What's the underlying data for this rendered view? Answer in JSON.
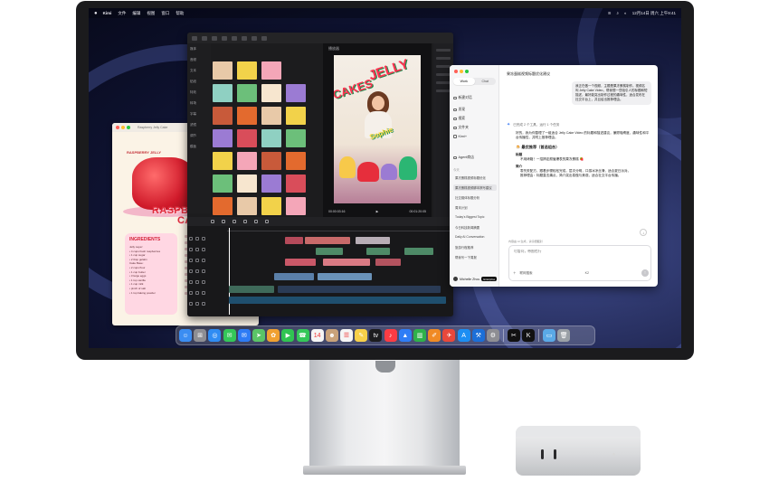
{
  "menubar": {
    "app_name": "Kimi",
    "items": [
      "文件",
      "编辑",
      "视图",
      "窗口",
      "帮助"
    ],
    "time": "12月14日 周六 上午9:41"
  },
  "recipe": {
    "doc_name": "Raspberry Jelly Cake",
    "kicker": "RASPBERRY JELLY",
    "headline_1": "RASPBERRY",
    "headline_2": "CAKE",
    "ingredients_title": "INGREDIENTS",
    "ingredients": [
      "Jelly Layer:",
      "• 4 cups fresh raspberries",
      "• 1 cup sugar",
      "• 2 tbsp gelatin",
      "Cake Base:",
      "• 2 cups flour",
      "• 1 cup butter",
      "• 3 large eggs",
      "• 1 tsp vanilla",
      "• 1 cup milk",
      "• pinch of salt",
      "• 1 tsp baking powder"
    ]
  },
  "editor": {
    "categories": [
      "媒体",
      "音频",
      "文本",
      "贴纸",
      "特效",
      "转场",
      "字幕",
      "滤镜",
      "调节",
      "模板"
    ],
    "preview_label": "播放器",
    "jelly_word": "JELLY",
    "cakes_word": "CAKES",
    "sophie_word": "Sophie",
    "timecode": "00:00:03:16",
    "duration": "00:01:20:05"
  },
  "chat": {
    "mode_work": "Work",
    "mode_chat": "Chat",
    "side_items": [
      "新建对话",
      "发现",
      "搜索",
      "文件夹",
      "Kimi+",
      "Agent商店"
    ],
    "section_recent": "今天",
    "conversations": [
      {
        "title": "果冻蛋糕视频标题优化",
        "selected": false
      },
      {
        "title": "果冻蛋糕视频脚本撰写建议",
        "selected": true
      },
      {
        "title": "社交媒体标题分析",
        "selected": false
      },
      {
        "title": "周末计划",
        "selected": false
      },
      {
        "title": "Today's Biggest Topic",
        "selected": false
      },
      {
        "title": "今日科技新闻摘要",
        "selected": false
      },
      {
        "title": "Daily AI Conversation",
        "selected": false
      },
      {
        "title": "旅游行程推荐",
        "selected": false
      },
      {
        "title": "帮我写一下周报",
        "selected": false
      }
    ],
    "user_name": "Michelle Zhou",
    "user_badge": "Enterprise",
    "title": "果冻蛋糕视频标题优化建议",
    "user_message": "我正在做一个视频，主题是果冻蛋糕制作。视频名叫 Jelly Cake Video，帮我想一些吸引人的标题和短描述，最好能突出制作过程的趣味性，适合发布在社交平台上，并且给出推荐理由。",
    "thinking": "已完成 2 个工具，运行 1 个任务",
    "answer_intro": "好的，我为你整理了一组适合 Jelly Cake Video 的标题和描述建议，兼顾吸睛度、趣味性和平台传播性，并附上推荐理由。",
    "answer_heading": "🍮 最优推荐（首选组合）",
    "answer_sub1": "标题",
    "answer_line1": "不用烤箱！一招搞定颜值爆表的果冻蛋糕 🍓",
    "answer_sub2": "简介",
    "answer_line2": "零失败配方，跟着步骤轻松完成，层次分明，口感冰凉丝滑，适合夏日派对。",
    "answer_line3": "推荐理由：标题直击痛点，简介突出易做与美观，适合社交平台传播。",
    "notice": "内容由 AI 生成，请仔细甄别",
    "composer_placeholder": "尽管问，带图也行",
    "model_label": "K2",
    "composer_tool": "联网搜索"
  },
  "dock": {
    "icons": [
      {
        "name": "finder-icon",
        "glyph": "☺",
        "color": "#3b8df2"
      },
      {
        "name": "launchpad-icon",
        "glyph": "⊞",
        "color": "#8e8e93"
      },
      {
        "name": "safari-icon",
        "glyph": "◎",
        "color": "#2f8cf3"
      },
      {
        "name": "messages-icon",
        "glyph": "✉",
        "color": "#34c759"
      },
      {
        "name": "mail-icon",
        "glyph": "✉",
        "color": "#2d7bf5"
      },
      {
        "name": "maps-icon",
        "glyph": "➤",
        "color": "#5ac467"
      },
      {
        "name": "photos-icon",
        "glyph": "✿",
        "color": "#f0a030"
      },
      {
        "name": "facetime-icon",
        "glyph": "▶",
        "color": "#30c452"
      },
      {
        "name": "phone-icon",
        "glyph": "☎",
        "color": "#34c759"
      },
      {
        "name": "calendar-icon",
        "glyph": "14",
        "color": "#f5f5f5"
      },
      {
        "name": "contacts-icon",
        "glyph": "☻",
        "color": "#c9a27a"
      },
      {
        "name": "reminders-icon",
        "glyph": "☰",
        "color": "#f5f5f5"
      },
      {
        "name": "notes-icon",
        "glyph": "✎",
        "color": "#f7d04a"
      },
      {
        "name": "tv-icon",
        "glyph": "tv",
        "color": "#1c1c1e"
      },
      {
        "name": "music-icon",
        "glyph": "♪",
        "color": "#fc3c44"
      },
      {
        "name": "keynote-icon",
        "glyph": "▲",
        "color": "#2f7df6"
      },
      {
        "name": "numbers-icon",
        "glyph": "▥",
        "color": "#2fb14a"
      },
      {
        "name": "pages-icon",
        "glyph": "✐",
        "color": "#f08a24"
      },
      {
        "name": "testflight-icon",
        "glyph": "✈",
        "color": "#e8483b"
      },
      {
        "name": "app-store-icon",
        "glyph": "A",
        "color": "#1c8ef3"
      },
      {
        "name": "xcode-icon",
        "glyph": "⚒",
        "color": "#1b6fd8"
      },
      {
        "name": "system-settings-icon",
        "glyph": "⚙",
        "color": "#8e8e93"
      },
      {
        "name": "capcut-icon",
        "glyph": "✂",
        "color": "#111111"
      },
      {
        "name": "kimi-icon",
        "glyph": "K",
        "color": "#111111"
      },
      {
        "name": "folder-icon",
        "glyph": "▭",
        "color": "#5aa9e6"
      },
      {
        "name": "trash-icon",
        "glyph": "🗑",
        "color": "#9aa0a6"
      }
    ]
  },
  "colors": {
    "accent": "#3d7ef5",
    "jelly_red": "#e02a3a",
    "wallpaper": "#232a57"
  }
}
